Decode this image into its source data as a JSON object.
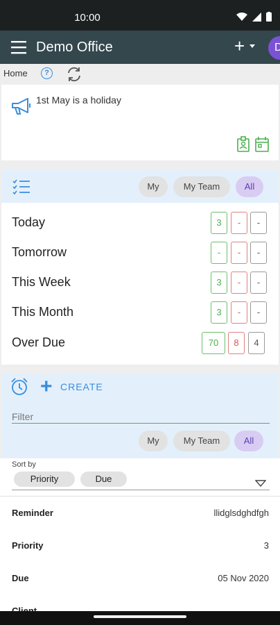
{
  "status": {
    "time": "10:00"
  },
  "appbar": {
    "title": "Demo Office",
    "avatar_letter": "D"
  },
  "crumb": {
    "home": "Home",
    "help": "?"
  },
  "announcement": {
    "text": "1st May is a holiday"
  },
  "tasks": {
    "filters": [
      "My",
      "My Team",
      "All"
    ],
    "selected_filter": "All",
    "rows": [
      {
        "label": "Today",
        "counts": [
          "3",
          "-",
          "-"
        ]
      },
      {
        "label": "Tomorrow",
        "counts": [
          "-",
          "-",
          "-"
        ]
      },
      {
        "label": "This Week",
        "counts": [
          "3",
          "-",
          "-"
        ]
      },
      {
        "label": "This Month",
        "counts": [
          "3",
          "-",
          "-"
        ]
      },
      {
        "label": "Over Due",
        "counts": [
          "70",
          "8",
          "4"
        ]
      }
    ]
  },
  "reminders": {
    "create_label": "CREATE",
    "filter_placeholder": "Filter",
    "filters": [
      "My",
      "My Team",
      "All"
    ],
    "selected_filter": "All"
  },
  "sort": {
    "label": "Sort by",
    "chips": [
      "Priority",
      "Due"
    ]
  },
  "detail": {
    "fields": [
      {
        "key": "Reminder",
        "value": "llidglsdghdfgh"
      },
      {
        "key": "Priority",
        "value": "3"
      },
      {
        "key": "Due",
        "value": "05 Nov 2020"
      },
      {
        "key": "Client",
        "value": ""
      }
    ]
  },
  "colors": {
    "accent": "#3a8dde",
    "purple": "#7b52d6",
    "appbar": "#33474d",
    "green": "#4caf50",
    "red": "#e05050"
  }
}
